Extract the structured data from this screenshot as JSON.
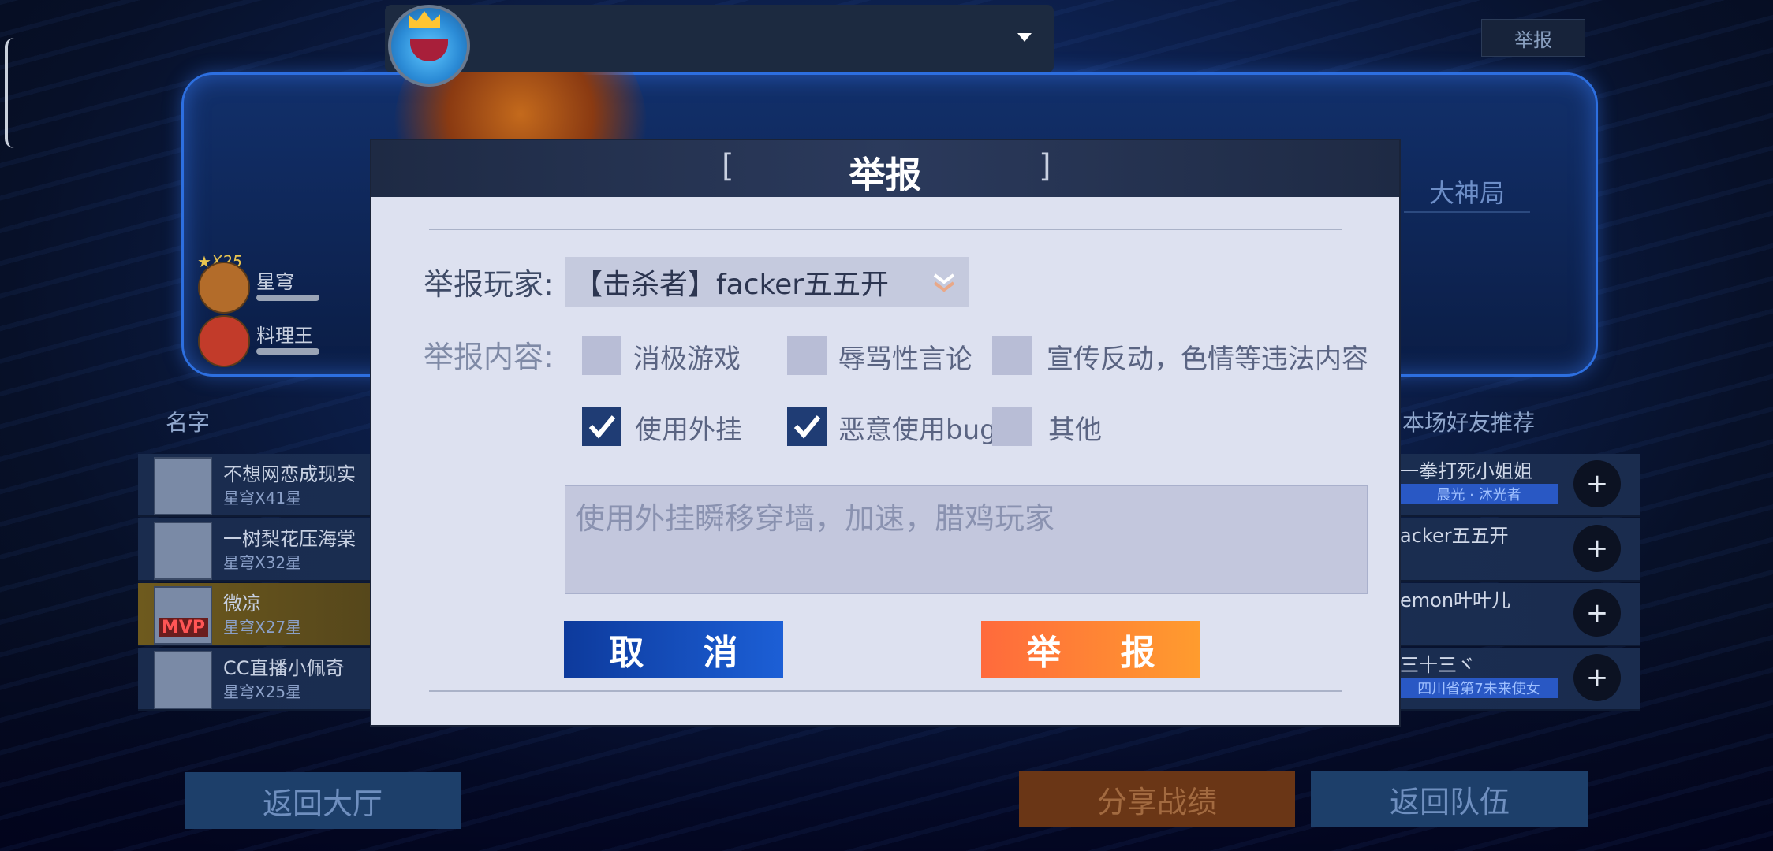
{
  "background": {
    "top_report_label": "举报",
    "mode_tag": "大神局",
    "team": {
      "stars": "★X25",
      "members": [
        {
          "name": "星穹"
        },
        {
          "name": "料理王"
        }
      ]
    },
    "column_headers": {
      "name": "名字",
      "friends": "本场好友推荐"
    },
    "player_rows": [
      {
        "name": "不想网恋成现实",
        "rank": "星穹X41星"
      },
      {
        "name": "一树梨花压海棠",
        "rank": "星穹X32星"
      },
      {
        "name": "微凉",
        "rank": "星穹X27星",
        "tag": "MVP"
      },
      {
        "name": "CC直播小佩奇",
        "rank": "星穹X25星"
      }
    ],
    "friend_rows": [
      {
        "name": "一拳打死小姐姐",
        "badge": "晨光 · 沐光者"
      },
      {
        "name": "acker五五开",
        "badge": ""
      },
      {
        "name": "emon叶叶儿",
        "badge": ""
      },
      {
        "name": "三十三ヾ",
        "badge": "四川省第7未来使女"
      }
    ],
    "bottom_buttons": {
      "lobby": "返回大厅",
      "share": "分享战绩",
      "team": "返回队伍"
    }
  },
  "dialog": {
    "title": "举报",
    "player_label": "举报玩家:",
    "selected_player": "【击杀者】facker五五开",
    "content_label": "举报内容:",
    "options": [
      {
        "label": "消极游戏",
        "checked": false
      },
      {
        "label": "辱骂性言论",
        "checked": false
      },
      {
        "label": "宣传反动，色情等违法内容",
        "checked": false
      },
      {
        "label": "使用外挂",
        "checked": true
      },
      {
        "label": "恶意使用bug",
        "checked": true
      },
      {
        "label": "其他",
        "checked": false
      }
    ],
    "description": "使用外挂瞬移穿墙，加速，腊鸡玩家",
    "cancel_label": "取 消",
    "submit_label": "举 报"
  },
  "colors": {
    "cancel": "#1c5fd6",
    "submit": "#ff8a34",
    "dialog_bg": "#dde1f0"
  }
}
